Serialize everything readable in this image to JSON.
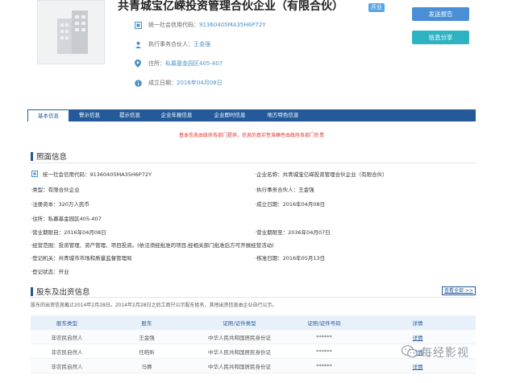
{
  "company": {
    "name": "共青城宝亿嵘投资管理合伙企业（有限合伙）",
    "status_tag": "开业"
  },
  "header_info": {
    "credit_code_label": "统一社会信用代码：",
    "credit_code_value": "91360405MA35H6P72Y",
    "partner_label": "执行事务合伙人：",
    "partner_value": "王金强",
    "address_label": "住所：",
    "address_value": "私募基金园区405-407",
    "established_label": "成立日期：",
    "established_value": "2016年04月08日"
  },
  "actions": {
    "report_label": "发送报告",
    "share_label": "信息分享"
  },
  "tabs": [
    {
      "label": "基本信息",
      "active": true
    },
    {
      "label": "警示信息",
      "active": false
    },
    {
      "label": "提示信息",
      "active": false
    },
    {
      "label": "企业年报信息",
      "active": false
    },
    {
      "label": "企业即时信息",
      "active": false
    },
    {
      "label": "地方特色信息",
      "active": false
    }
  ],
  "notice": "基本信息由政府各部门提供，信息的真实性准确性由政府各部门负责",
  "license_section": {
    "title": "照面信息",
    "fields": {
      "credit_code": "统一社会信用代码：91360405MA35H6P72Y",
      "enterprise_name": "·企业名称：共青城宝亿嵘投资管理合伙企业（有限合伙）",
      "type": "·类型：有限合伙企业",
      "partner": "·执行事务合伙人：王金强",
      "capital": "·注册资本：320万人民币",
      "established": "·成立日期：2016年04月08日",
      "address": "·住所：私募基金园区405-407",
      "term_from": "·营业期限自：2016年04月08日",
      "term_to": "·营业期限至：2036年04月07日",
      "scope": "·经营范围：投资管理、资产管理、项目投资。(依法须经批准的项目,经相关部门批准后方可开展经营活动)",
      "authority": "·登记机关：共青城市市场和质量监督管理局",
      "approval_date": "·核准日期：2016年05月13日",
      "reg_status": "·登记状态：开业"
    }
  },
  "shareholder_section": {
    "title": "股东及出资信息",
    "more_label": "查看全部 >>",
    "note": "股东的出资信息截止2014年2月28日。2014年2月28日之后工商只公示股东姓名，其他出资信息由企业自行公示。",
    "headers": [
      "股东类型",
      "股东",
      "证照/证件类型",
      "证照/证件号码",
      "详情"
    ],
    "rows": [
      [
        "非农民自然人",
        "王金强",
        "中华人民共和国居民身份证",
        "******",
        "详情"
      ],
      [
        "非农民自然人",
        "任皓昕",
        "中华人民共和国居民身份证",
        "******",
        "详情"
      ],
      [
        "非农民自然人",
        "马赛",
        "中华人民共和国居民身份证",
        "******",
        "详情"
      ]
    ]
  },
  "watermark": "每经影视",
  "colors": {
    "primary": "#245a99",
    "report_button": "#4a8fd6",
    "share_button": "#2eb3c2",
    "notice_red": "#e2342a",
    "status_tag": "#58a5e6"
  }
}
